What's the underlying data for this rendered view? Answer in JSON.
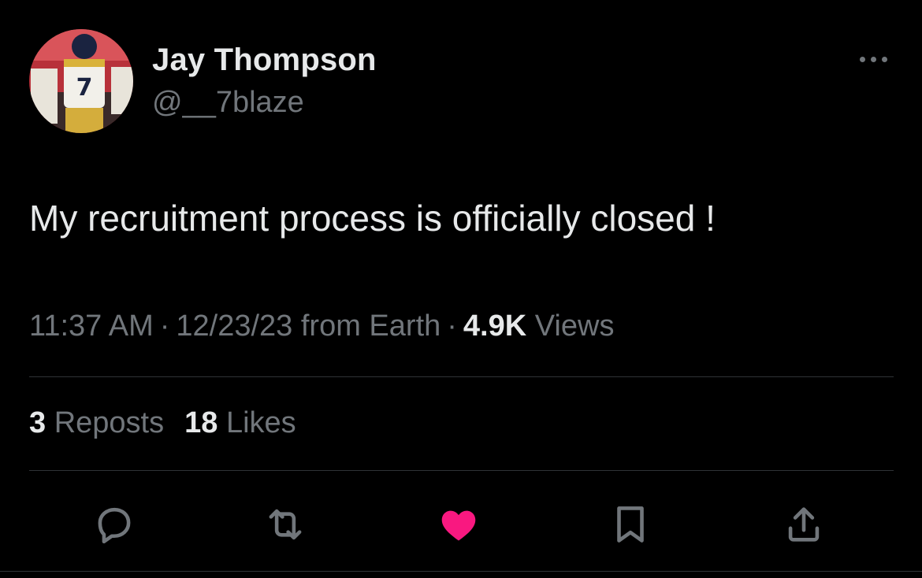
{
  "user": {
    "name": "Jay Thompson",
    "handle": "@__7blaze",
    "avatar_jersey_number": "7"
  },
  "tweet": {
    "text": "My recruitment process is officially closed !",
    "time": "11:37 AM",
    "date": "12/23/23",
    "source": "from Earth",
    "views_count": "4.9K",
    "views_label": "Views",
    "separator": "·"
  },
  "stats": {
    "reposts_count": "3",
    "reposts_label": "Reposts",
    "likes_count": "18",
    "likes_label": "Likes"
  },
  "actions": [
    {
      "icon": "reply-icon"
    },
    {
      "icon": "repost-icon"
    },
    {
      "icon": "heart-icon",
      "active": true
    },
    {
      "icon": "bookmark-icon"
    },
    {
      "icon": "share-icon"
    }
  ],
  "colors": {
    "background": "#000000",
    "text_primary": "#e7e9ea",
    "text_secondary": "#71767b",
    "divider": "#2f3336",
    "like_active": "#f91880"
  }
}
